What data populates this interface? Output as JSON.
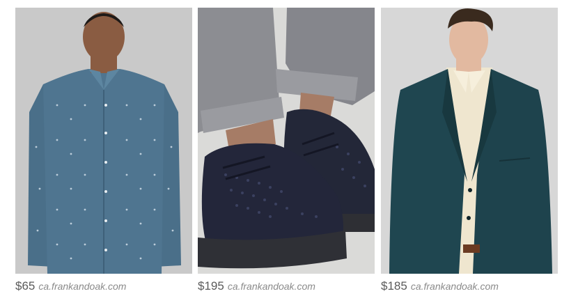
{
  "products": [
    {
      "image_name": "man in blue polka dot button-down shirt",
      "price": "$65",
      "source": "ca.frankandoak.com",
      "colors": {
        "bg": "#c9c9c9",
        "shirt": "#4f7590",
        "skin": "#8a5c42"
      }
    },
    {
      "image_name": "navy woven chukka sneakers with grey rolled trousers",
      "price": "$195",
      "source": "ca.frankandoak.com",
      "colors": {
        "bg": "#dadad8",
        "pants": "#8c8d92",
        "shoe": "#232738"
      }
    },
    {
      "image_name": "man in dark teal blazer over cream shirt",
      "price": "$185",
      "source": "ca.frankandoak.com",
      "colors": {
        "bg": "#d7d7d7",
        "blazer": "#1f4650",
        "shirt": "#efe6cf",
        "skin": "#e2b9a0"
      }
    }
  ]
}
